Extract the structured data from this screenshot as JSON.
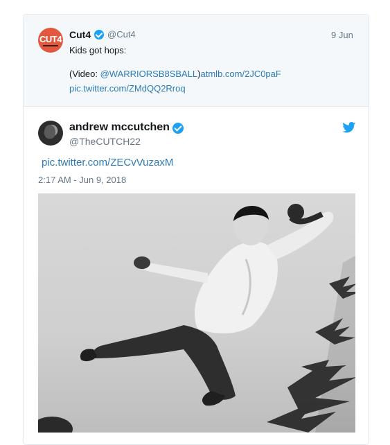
{
  "quoted_tweet": {
    "logo_text": "CUT4",
    "name": "Cut4",
    "handle": "@Cut4",
    "date": "9 Jun",
    "text_line1": "Kids got hops:",
    "text_line2_prefix": "(Video: ",
    "text_line2_mention": "@WARRIORSB8SBALL",
    "text_line2_suffix": ")",
    "text_line2_link": "atmlb.com/2JC0paF",
    "text_line3": "pic.twitter.com/ZMdQQ2Rroq"
  },
  "tweet": {
    "name": "andrew mccutchen",
    "handle": "@TheCUTCH22",
    "link": "pic.twitter.com/ZECvVuzaxM",
    "timestamp": "2:17 AM - Jun 9, 2018"
  },
  "icons": {
    "verified": "verified-badge-icon",
    "twitter": "twitter-bird-icon"
  },
  "colors": {
    "link": "#2b7bb9",
    "verified": "#1da1f2",
    "secondary_text": "#657786",
    "quote_bg": "#f5f8fa",
    "cut4_brand": "#e2583e"
  }
}
